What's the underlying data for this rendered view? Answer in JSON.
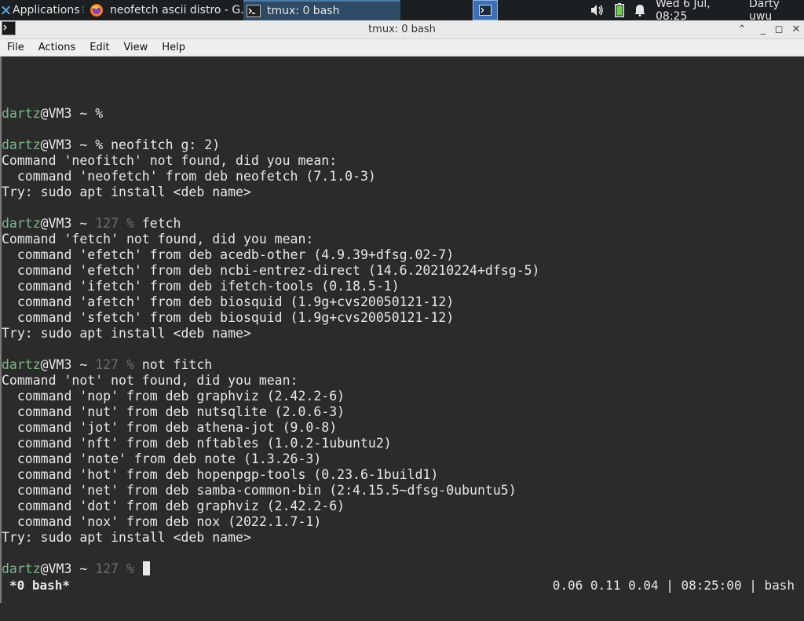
{
  "panel": {
    "applications_label": "Applications",
    "tasks": [
      {
        "label": "neofetch ascii distro - G..."
      },
      {
        "label": "tmux: 0 bash"
      }
    ],
    "clock": "Wed  6 Jul, 08:25",
    "user": "Darty uwu"
  },
  "window": {
    "title": "tmux: 0 bash"
  },
  "menubar": {
    "items": [
      "File",
      "Actions",
      "Edit",
      "View",
      "Help"
    ]
  },
  "terminal": {
    "lines": [
      {
        "parts": [
          {
            "t": "dartz",
            "c": "user"
          },
          {
            "t": "@VM3 ~ %",
            "c": ""
          }
        ]
      },
      {
        "parts": []
      },
      {
        "parts": [
          {
            "t": "dartz",
            "c": "user"
          },
          {
            "t": "@VM3 ~ % neofitch g: 2)",
            "c": ""
          }
        ]
      },
      {
        "parts": [
          {
            "t": "Command 'neofitch' not found, did you mean:",
            "c": ""
          }
        ]
      },
      {
        "parts": [
          {
            "t": "  command 'neofetch' from deb neofetch (7.1.0-3)",
            "c": ""
          }
        ]
      },
      {
        "parts": [
          {
            "t": "Try: sudo apt install <deb name>",
            "c": ""
          }
        ]
      },
      {
        "parts": []
      },
      {
        "parts": [
          {
            "t": "dartz",
            "c": "user"
          },
          {
            "t": "@VM3 ~ ",
            "c": ""
          },
          {
            "t": "127 %",
            "c": "dim"
          },
          {
            "t": " fetch",
            "c": ""
          }
        ]
      },
      {
        "parts": [
          {
            "t": "Command 'fetch' not found, did you mean:",
            "c": ""
          }
        ]
      },
      {
        "parts": [
          {
            "t": "  command 'efetch' from deb acedb-other (4.9.39+dfsg.02-7)",
            "c": ""
          }
        ]
      },
      {
        "parts": [
          {
            "t": "  command 'efetch' from deb ncbi-entrez-direct (14.6.20210224+dfsg-5)",
            "c": ""
          }
        ]
      },
      {
        "parts": [
          {
            "t": "  command 'ifetch' from deb ifetch-tools (0.18.5-1)",
            "c": ""
          }
        ]
      },
      {
        "parts": [
          {
            "t": "  command 'afetch' from deb biosquid (1.9g+cvs20050121-12)",
            "c": ""
          }
        ]
      },
      {
        "parts": [
          {
            "t": "  command 'sfetch' from deb biosquid (1.9g+cvs20050121-12)",
            "c": ""
          }
        ]
      },
      {
        "parts": [
          {
            "t": "Try: sudo apt install <deb name>",
            "c": ""
          }
        ]
      },
      {
        "parts": []
      },
      {
        "parts": [
          {
            "t": "dartz",
            "c": "user"
          },
          {
            "t": "@VM3 ~ ",
            "c": ""
          },
          {
            "t": "127 %",
            "c": "dim"
          },
          {
            "t": " not fitch",
            "c": ""
          }
        ]
      },
      {
        "parts": [
          {
            "t": "Command 'not' not found, did you mean:",
            "c": ""
          }
        ]
      },
      {
        "parts": [
          {
            "t": "  command 'nop' from deb graphviz (2.42.2-6)",
            "c": ""
          }
        ]
      },
      {
        "parts": [
          {
            "t": "  command 'nut' from deb nutsqlite (2.0.6-3)",
            "c": ""
          }
        ]
      },
      {
        "parts": [
          {
            "t": "  command 'jot' from deb athena-jot (9.0-8)",
            "c": ""
          }
        ]
      },
      {
        "parts": [
          {
            "t": "  command 'nft' from deb nftables (1.0.2-1ubuntu2)",
            "c": ""
          }
        ]
      },
      {
        "parts": [
          {
            "t": "  command 'note' from deb note (1.3.26-3)",
            "c": ""
          }
        ]
      },
      {
        "parts": [
          {
            "t": "  command 'hot' from deb hopenpgp-tools (0.23.6-1build1)",
            "c": ""
          }
        ]
      },
      {
        "parts": [
          {
            "t": "  command 'net' from deb samba-common-bin (2:4.15.5~dfsg-0ubuntu5)",
            "c": ""
          }
        ]
      },
      {
        "parts": [
          {
            "t": "  command 'dot' from deb graphviz (2.42.2-6)",
            "c": ""
          }
        ]
      },
      {
        "parts": [
          {
            "t": "  command 'nox' from deb nox (2022.1.7-1)",
            "c": ""
          }
        ]
      },
      {
        "parts": [
          {
            "t": "Try: sudo apt install <deb name>",
            "c": ""
          }
        ]
      },
      {
        "parts": []
      },
      {
        "parts": [
          {
            "t": "dartz",
            "c": "user"
          },
          {
            "t": "@VM3 ~ ",
            "c": ""
          },
          {
            "t": "127 %",
            "c": "dim"
          },
          {
            "t": " ",
            "c": ""
          }
        ],
        "cursor": true
      }
    ]
  },
  "tmux_status": {
    "left": "*0 bash*",
    "right": "0.06 0.11 0.04 | 08:25:00 | bash"
  },
  "icons": {
    "applications": "xfce-mouse-icon",
    "firefox": "firefox-icon",
    "terminal": "terminal-icon",
    "volume": "volume-icon",
    "battery": "battery-icon",
    "notifications": "bell-icon"
  },
  "colors": {
    "prompt_user": "#7fb58a",
    "dim_exit_code": "#6d6d6d",
    "terminal_bg": "#2b2b2b",
    "panel_bg": "#1b1f22",
    "workspace_active": "#3b6fb6"
  }
}
